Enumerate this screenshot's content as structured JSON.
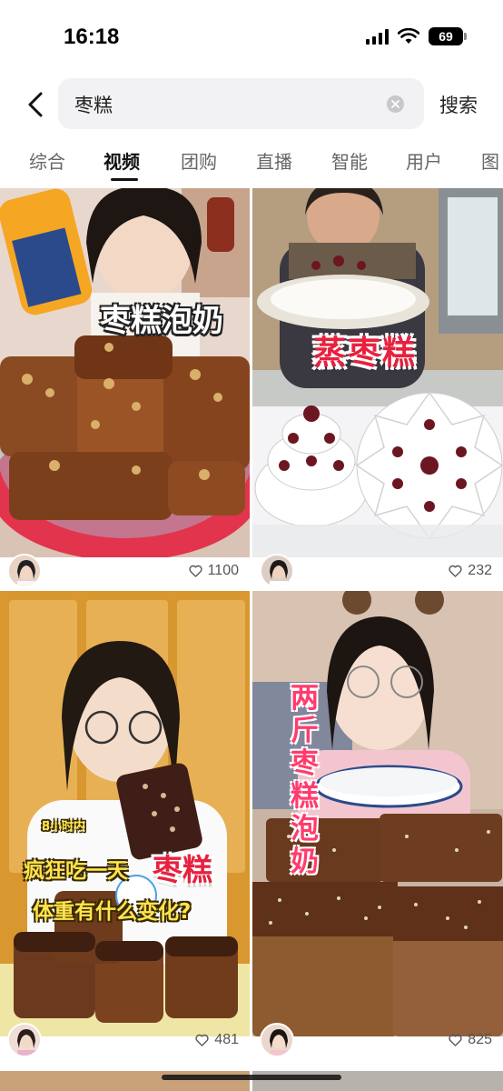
{
  "status": {
    "time": "16:18",
    "battery": "69"
  },
  "search": {
    "query": "枣糕",
    "submit_label": "搜索"
  },
  "tabs": [
    {
      "label": "综合"
    },
    {
      "label": "视频"
    },
    {
      "label": "团购"
    },
    {
      "label": "直播"
    },
    {
      "label": "智能"
    },
    {
      "label": "用户"
    },
    {
      "label": "图"
    }
  ],
  "active_tab": "视频",
  "results": [
    {
      "overlay": "枣糕泡奶",
      "likes": "1100"
    },
    {
      "overlay": "蒸枣糕",
      "likes": "232"
    },
    {
      "overlay_top": "8小时内",
      "overlay_line1a": "疯狂吃一天",
      "overlay_line1b": "枣糕",
      "overlay_line2": "体重有什么变化?",
      "likes": "481"
    },
    {
      "overlay": "两斤枣糕泡奶",
      "likes": "825"
    }
  ],
  "colors": {
    "accent_text": "#111111",
    "overlay_red": "#e7213f",
    "overlay_yellow": "#ffe44d"
  }
}
